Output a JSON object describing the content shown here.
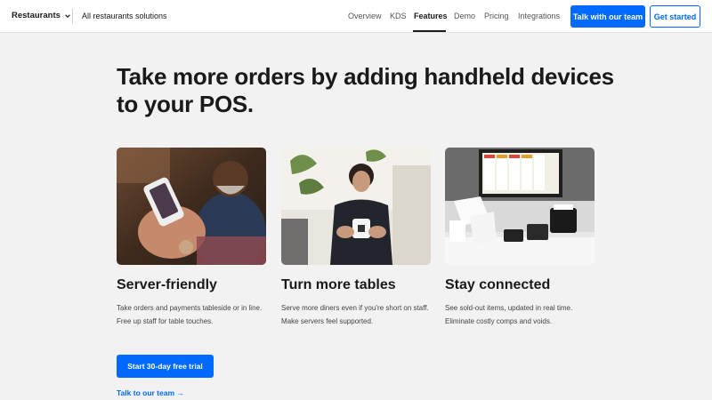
{
  "header": {
    "brand_menu": "Restaurants",
    "solutions_link": "All restaurants solutions",
    "nav": [
      {
        "label": "Overview"
      },
      {
        "label": "KDS"
      },
      {
        "label": "Features",
        "active": true
      },
      {
        "label": "Demo"
      },
      {
        "label": "Pricing"
      },
      {
        "label": "Integrations"
      }
    ],
    "talk_button": "Talk with our team",
    "get_started_button": "Get started"
  },
  "hero": {
    "headline": "Take more orders by adding handheld devices to your POS."
  },
  "cards": [
    {
      "title": "Server-friendly",
      "description": "Take orders and payments tableside or in line. Free up staff for table touches."
    },
    {
      "title": "Turn more tables",
      "description": "Serve more diners even if you’re short on staff. Make servers feel supported."
    },
    {
      "title": "Stay connected",
      "description": "See sold-out items, updated in real time. Eliminate costly comps and voids."
    }
  ],
  "cta": {
    "trial_button": "Start 30-day free trial",
    "talk_link": "Talk to our team →"
  },
  "colors": {
    "accent": "#006aff",
    "background": "#f2f2f2"
  }
}
